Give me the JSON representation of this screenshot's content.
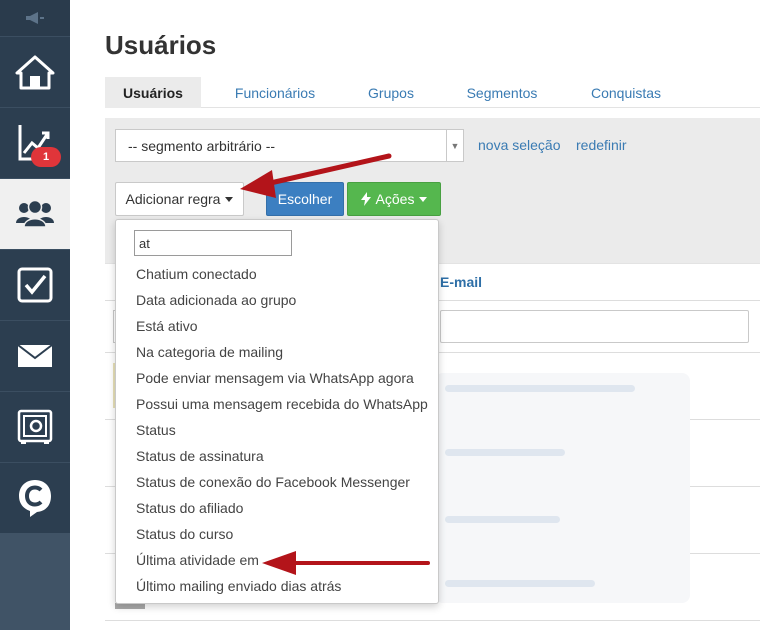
{
  "sidebar": {
    "items": [
      {
        "icon": "home-icon"
      },
      {
        "icon": "chart-icon",
        "badge": "1"
      },
      {
        "icon": "users-icon",
        "active": true
      },
      {
        "icon": "checkbox-icon"
      },
      {
        "icon": "mail-icon"
      },
      {
        "icon": "safe-icon"
      },
      {
        "icon": "chatium-logo-icon"
      }
    ],
    "top_icon": "megaphone-icon"
  },
  "page": {
    "title": "Usuários"
  },
  "tabs": [
    {
      "label": "Usuários",
      "active": true
    },
    {
      "label": "Funcionários"
    },
    {
      "label": "Grupos"
    },
    {
      "label": "Segmentos"
    },
    {
      "label": "Conquistas"
    }
  ],
  "filter": {
    "segment_select": "-- segmento arbitrário --",
    "new_selection": "nova seleção",
    "reset": "redefinir",
    "add_rule": "Adicionar regra",
    "choose": "Escolher",
    "actions": "Ações"
  },
  "table": {
    "email_header": "E-mail"
  },
  "dropdown": {
    "search_value": "at",
    "items": [
      "Chatium conectado",
      "Data adicionada ao grupo",
      "Está ativo",
      "Na categoria de mailing",
      "Pode enviar mensagem via WhatsApp agora",
      "Possui uma mensagem recebida do WhatsApp",
      "Status",
      "Status de assinatura",
      "Status de conexão do Facebook Messenger",
      "Status do afiliado",
      "Status do curso",
      "Última atividade em",
      "Último mailing enviado dias atrás"
    ]
  },
  "colors": {
    "sidebar": "#2c3e50",
    "link": "#3a7bb3",
    "primary_button": "#3c7fc1",
    "success_button": "#55b74e",
    "badge": "#e0353a",
    "annotation_arrow": "#b3141a"
  }
}
